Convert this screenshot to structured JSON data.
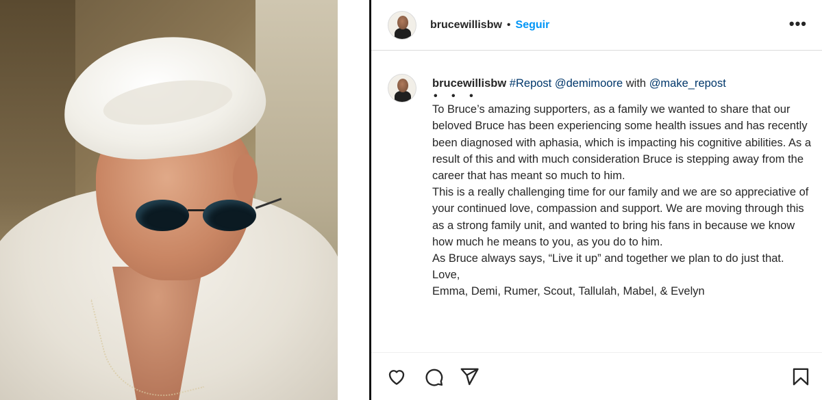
{
  "post": {
    "username": "brucewillisbw",
    "separator": "•",
    "follow_label": "Seguir",
    "more_label": "•••"
  },
  "caption": {
    "username": "brucewillisbw",
    "repost_tag": "#Repost",
    "mention_demi": "@demimoore",
    "with_text": "with",
    "mention_make": "@make_repost",
    "dots": "• • •",
    "paragraphs": [
      "To Bruce’s amazing supporters, as a family we wanted to share that our beloved Bruce has been experiencing some health issues and has recently been diagnosed with aphasia, which is impacting his cognitive abilities. As a result of this and with much consideration Bruce is stepping away from the career that has meant so much to him.",
      "This is a really challenging time for our family and we are so appreciative of your continued love, compassion and support. We are moving through this as a strong family unit, and wanted to bring his fans in because we know how much he means to you, as you do to him.",
      "As Bruce always says, “Live it up” and together we plan to do just that.",
      "Love,",
      "Emma, Demi, Rumer, Scout, Tallulah, Mabel, & Evelyn"
    ]
  },
  "actions": {
    "like_icon": "heart-icon",
    "comment_icon": "comment-icon",
    "share_icon": "paper-plane-icon",
    "save_icon": "bookmark-icon"
  },
  "colors": {
    "link": "#00376b",
    "follow": "#0095f6",
    "text": "#262626",
    "border": "#dbdbdb"
  }
}
